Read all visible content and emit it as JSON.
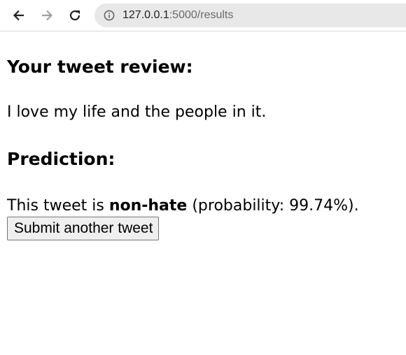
{
  "browser": {
    "url_host": "127.0.0.1",
    "url_rest": ":5000/results",
    "icons": {
      "back": "back-arrow-icon",
      "forward": "forward-arrow-icon",
      "reload": "reload-icon",
      "site_info": "info-icon"
    }
  },
  "page": {
    "review_heading": "Your tweet review:",
    "review_text": "I love my life and the people in it.",
    "prediction_heading": "Prediction:",
    "prediction_prefix": "This tweet is ",
    "prediction_label": "non-hate",
    "prediction_suffix": " (probability: 99.74%).",
    "submit_button_label": "Submit another tweet"
  }
}
